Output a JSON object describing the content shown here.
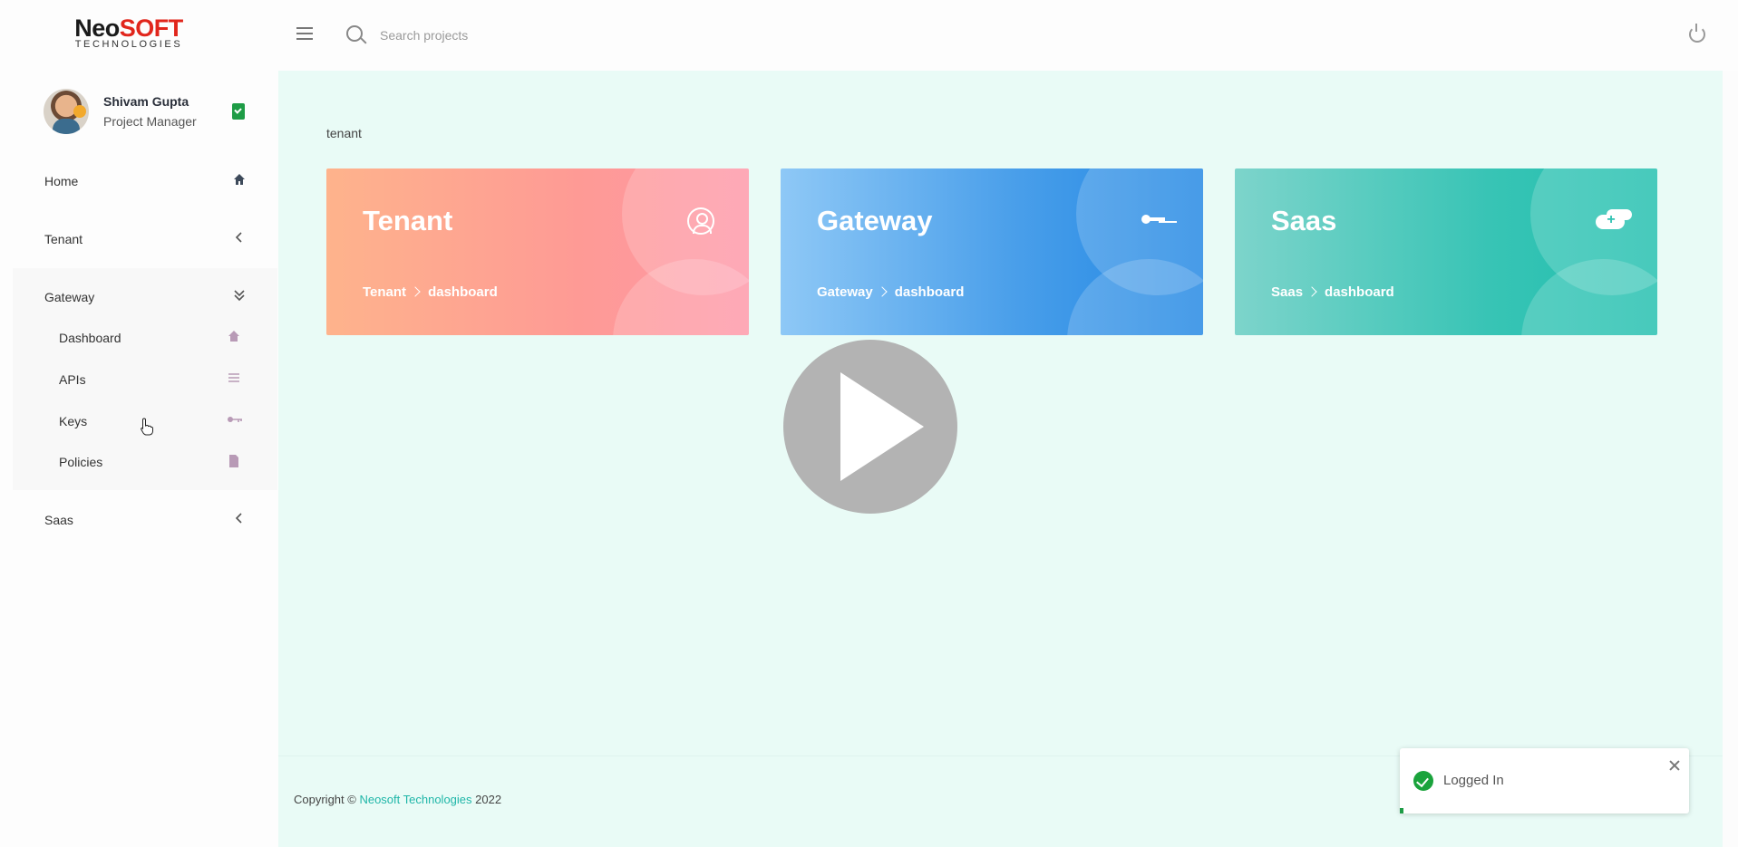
{
  "brand": {
    "main_part1": "Neo",
    "main_part2": "SOFT",
    "sub": "TECHNOLOGIES"
  },
  "profile": {
    "name": "Shivam Gupta",
    "role": "Project Manager"
  },
  "sidebar": {
    "items": [
      {
        "label": "Home",
        "icon": "home-icon"
      },
      {
        "label": "Tenant",
        "icon": "chevron-left-icon"
      },
      {
        "label": "Gateway",
        "icon": "double-chevron-down-icon",
        "expanded": true,
        "children": [
          {
            "label": "Dashboard",
            "icon": "home-icon"
          },
          {
            "label": "APIs",
            "icon": "list-icon"
          },
          {
            "label": "Keys",
            "icon": "key-icon"
          },
          {
            "label": "Policies",
            "icon": "document-icon"
          }
        ]
      },
      {
        "label": "Saas",
        "icon": "chevron-left-icon"
      }
    ]
  },
  "topbar": {
    "search_placeholder": "Search projects"
  },
  "main": {
    "breadcrumb": "tenant",
    "cards": [
      {
        "title": "Tenant",
        "crumb_parent": "Tenant",
        "crumb_child": "dashboard",
        "icon": "user-circle-icon"
      },
      {
        "title": "Gateway",
        "crumb_parent": "Gateway",
        "crumb_child": "dashboard",
        "icon": "key-icon"
      },
      {
        "title": "Saas",
        "crumb_parent": "Saas",
        "crumb_child": "dashboard",
        "icon": "cloud-upload-icon"
      }
    ]
  },
  "footer": {
    "prefix": "Copyright © ",
    "brand": "Neosoft Technologies",
    "year": " 2022"
  },
  "toast": {
    "message": "Logged In",
    "status_color": "#1aa33c"
  },
  "colors": {
    "accent": "#1fb6a8",
    "brand_red": "#e1261c",
    "main_bg": "#e9fbf6"
  }
}
